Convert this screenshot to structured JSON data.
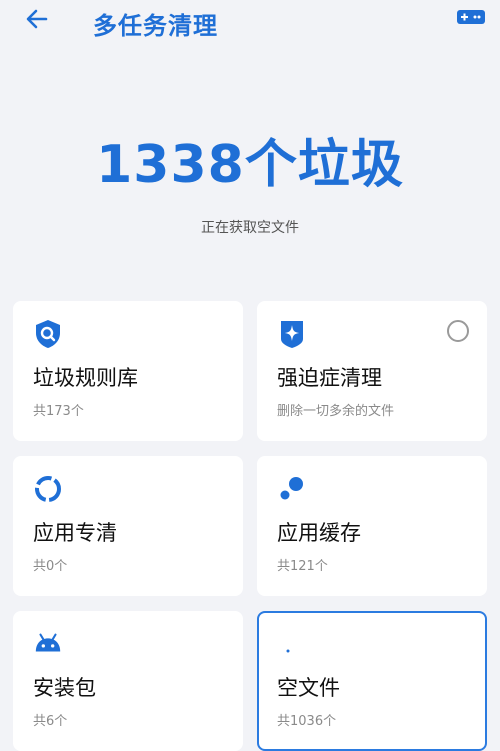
{
  "header": {
    "title": "多任务清理",
    "back_icon": "back-arrow-icon",
    "game_icon": "game-controller-icon"
  },
  "hero": {
    "count_label": "1338个垃圾",
    "status": "正在获取空文件"
  },
  "cards": [
    {
      "title": "垃圾规则库",
      "subtitle": "共173个",
      "icon": "shield-search-icon"
    },
    {
      "title": "强迫症清理",
      "subtitle": "删除一切多余的文件",
      "icon": "sparkle-shield-icon",
      "has_radio": true
    },
    {
      "title": "应用专清",
      "subtitle": "共0个",
      "icon": "ring-progress-icon"
    },
    {
      "title": "应用缓存",
      "subtitle": "共121个",
      "icon": "bubbles-icon"
    },
    {
      "title": "安装包",
      "subtitle": "共6个",
      "icon": "android-icon"
    },
    {
      "title": "空文件",
      "subtitle": "共1036个",
      "icon": "dot-icon",
      "selected": true
    }
  ],
  "colors": {
    "accent": "#1f6fd6",
    "background": "#f2f3f7",
    "card": "#ffffff",
    "subtext": "#8a8a8a"
  }
}
